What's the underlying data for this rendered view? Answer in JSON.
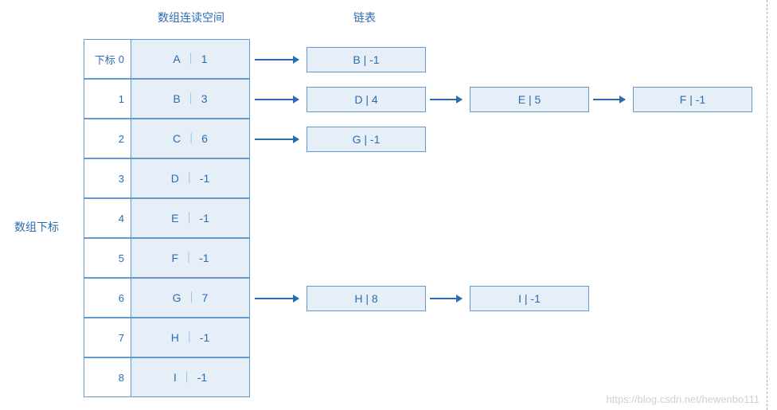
{
  "headers": {
    "array_space": "数组连读空间",
    "linked_list": "链表"
  },
  "side_label": "数组下标",
  "index_prefix": "下标",
  "array": [
    {
      "index": "0",
      "key": "A",
      "val": "1"
    },
    {
      "index": "1",
      "key": "B",
      "val": "3"
    },
    {
      "index": "2",
      "key": "C",
      "val": "6"
    },
    {
      "index": "3",
      "key": "D",
      "val": "-1"
    },
    {
      "index": "4",
      "key": "E",
      "val": "-1"
    },
    {
      "index": "5",
      "key": "F",
      "val": "-1"
    },
    {
      "index": "6",
      "key": "G",
      "val": "7"
    },
    {
      "index": "7",
      "key": "H",
      "val": "-1"
    },
    {
      "index": "8",
      "key": "I",
      "val": "-1"
    }
  ],
  "nodes": {
    "r0n0": "B | -1",
    "r1n0": "D | 4",
    "r1n1": "E | 5",
    "r1n2": "F | -1",
    "r2n0": "G | -1",
    "r6n0": "H | 8",
    "r6n1": "I | -1"
  },
  "watermark": "https://blog.csdn.net/hewenbo111"
}
